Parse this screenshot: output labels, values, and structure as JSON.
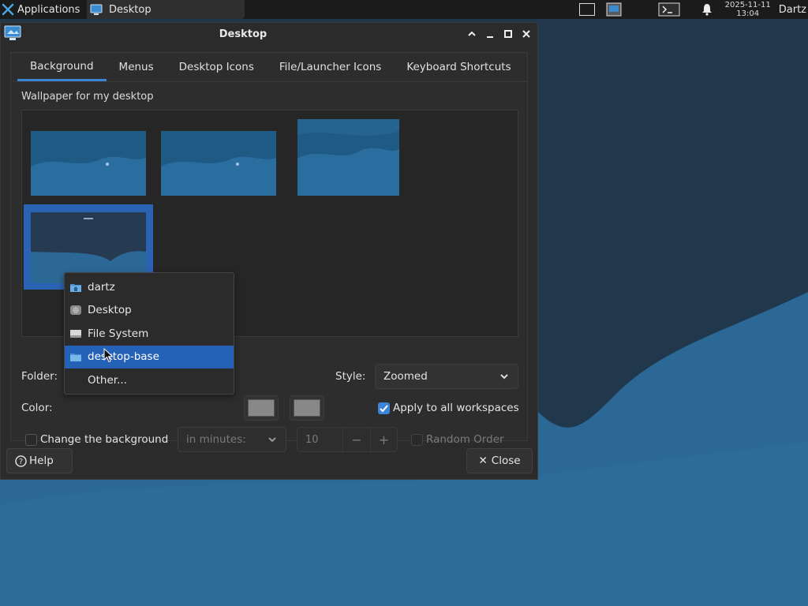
{
  "panel": {
    "apps_label": "Applications",
    "task_label": "Desktop",
    "clock_date": "2025-11-11",
    "clock_time": "13:04",
    "user": "Dartz"
  },
  "window": {
    "title": "Desktop",
    "tabs": [
      {
        "label": "Background",
        "active": true
      },
      {
        "label": "Menus",
        "active": false
      },
      {
        "label": "Desktop Icons",
        "active": false
      },
      {
        "label": "File/Launcher Icons",
        "active": false
      },
      {
        "label": "Keyboard Shortcuts",
        "active": false
      }
    ],
    "wallpaper_label": "Wallpaper for my desktop",
    "folder_label": "Folder:",
    "color_label": "Color:",
    "style_label": "Style:",
    "style_value": "Zoomed",
    "apply_all_label": "Apply to all workspaces",
    "apply_all_checked": true,
    "change_bg_label": "Change the background",
    "change_bg_checked": false,
    "interval_unit": "in minutes:",
    "interval_value": "10",
    "random_order_label": "Random Order",
    "random_order_checked": false,
    "help_label": "Help",
    "close_label": "Close",
    "color_swatch_1": "#888888",
    "color_swatch_2": "#888888"
  },
  "folder_menu": {
    "items": [
      {
        "label": "dartz",
        "icon": "folder-home-icon",
        "active": false
      },
      {
        "label": "Desktop",
        "icon": "desktop-folder-icon",
        "active": false
      },
      {
        "label": "File System",
        "icon": "drive-icon",
        "active": false
      },
      {
        "label": "desktop-base",
        "icon": "folder-icon",
        "active": true
      },
      {
        "label": "Other...",
        "icon": "",
        "active": false
      }
    ]
  },
  "colors": {
    "accent": "#3d83d6",
    "selection": "#2462b8",
    "window_bg": "#2b2b2b",
    "desktop_dark": "#21374b",
    "desktop_light": "#2e6c9c"
  }
}
